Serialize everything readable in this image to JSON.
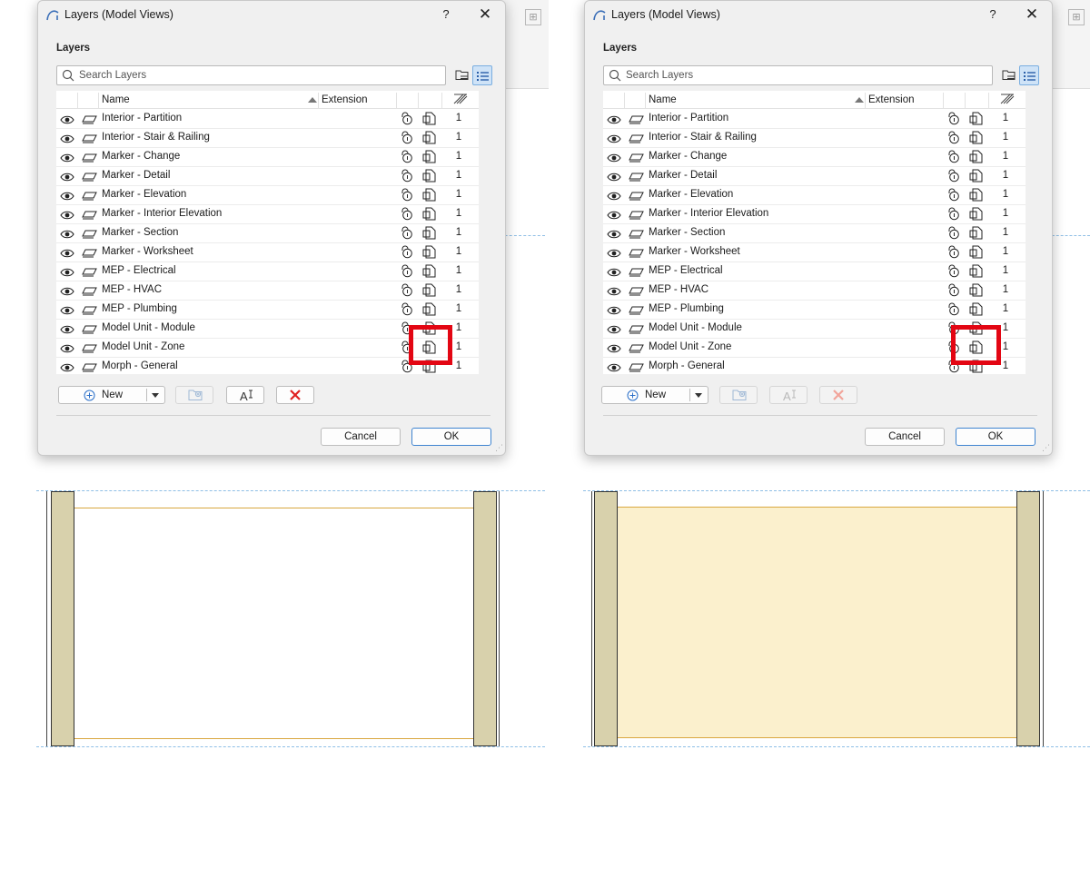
{
  "dialog": {
    "title": "Layers (Model Views)",
    "help_label": "?",
    "close_label": "✕",
    "section_label": "Layers",
    "search_placeholder": "Search Layers",
    "columns": {
      "name": "Name",
      "extension": "Extension"
    },
    "rows": [
      {
        "name": "Interior - Partition",
        "value": "1"
      },
      {
        "name": "Interior - Stair & Railing",
        "value": "1"
      },
      {
        "name": "Marker - Change",
        "value": "1"
      },
      {
        "name": "Marker - Detail",
        "value": "1"
      },
      {
        "name": "Marker - Elevation",
        "value": "1"
      },
      {
        "name": "Marker - Interior Elevation",
        "value": "1"
      },
      {
        "name": "Marker - Section",
        "value": "1"
      },
      {
        "name": "Marker - Worksheet",
        "value": "1"
      },
      {
        "name": "MEP - Electrical",
        "value": "1"
      },
      {
        "name": "MEP - HVAC",
        "value": "1"
      },
      {
        "name": "MEP - Plumbing",
        "value": "1"
      },
      {
        "name": "Model Unit - Module",
        "value": "1"
      },
      {
        "name": "Model Unit - Zone",
        "value": "1"
      },
      {
        "name": "Morph - General",
        "value": "1"
      }
    ],
    "buttons": {
      "new": "New",
      "cancel": "Cancel",
      "ok": "OK"
    },
    "icons": {
      "visibility": "eye-icon",
      "layer": "layer-stack-icon",
      "lock": "lock-icon",
      "wireframe": "wireframe-view-icon",
      "pen": "pen-set-icon",
      "folder_view": "folder-tree-icon",
      "list_view": "list-view-icon",
      "add": "plus-circle-icon",
      "new_folder": "new-folder-icon",
      "rename": "rename-text-icon",
      "delete": "red-x-delete-icon"
    }
  },
  "colors": {
    "highlight": "#e30613",
    "column_fill": "#d8d1ac",
    "zone_fill_right": "#fbf0cd",
    "zone_line": "#d9a73f",
    "guide_line": "#8fbfe6",
    "ok_border": "#3f84d0",
    "list_view_active": "#cfe3f7"
  }
}
